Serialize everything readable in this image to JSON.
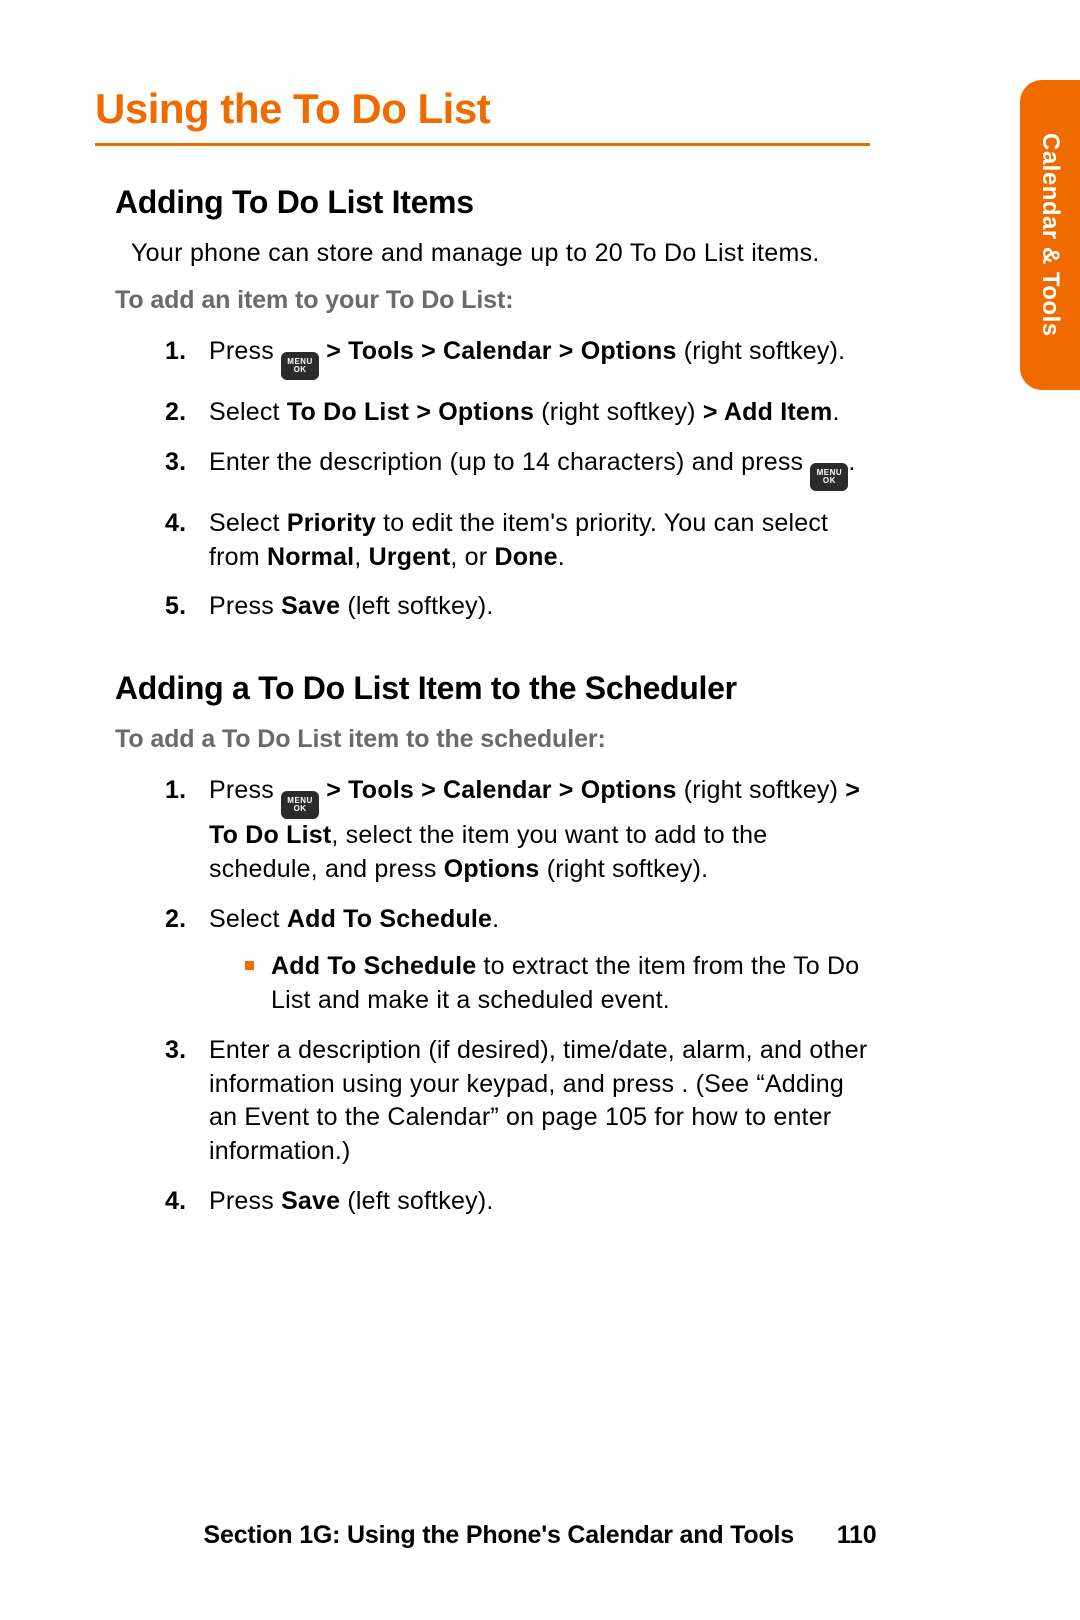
{
  "page_title": "Using the To Do List",
  "side_tab": "Calendar & Tools",
  "footer_section": "Section 1G: Using the Phone's Calendar and Tools",
  "footer_page": "110",
  "menuok": {
    "line1": "MENU",
    "line2": "OK"
  },
  "section1": {
    "heading": "Adding To Do List Items",
    "intro": "Your phone can store and manage up to 20 To Do List items.",
    "subhead": "To add an item to your To Do List:",
    "steps": {
      "s1_a": "Press ",
      "s1_b": " > Tools > Calendar > Options",
      "s1_c": " (right softkey).",
      "s2_a": "Select ",
      "s2_b": "To Do List > Options",
      "s2_c": " (right softkey) ",
      "s2_d": "> Add Item",
      "s2_e": ".",
      "s3_a": "Enter the description (up to 14 characters) and press ",
      "s3_b": ".",
      "s4_a": "Select ",
      "s4_b": "Priority",
      "s4_c": " to edit the item's priority. You can select from ",
      "s4_d": "Normal",
      "s4_e": ", ",
      "s4_f": "Urgent",
      "s4_g": ", or ",
      "s4_h": "Done",
      "s4_i": ".",
      "s5_a": "Press ",
      "s5_b": "Save",
      "s5_c": " (left softkey)."
    }
  },
  "section2": {
    "heading": "Adding a To Do List Item to the Scheduler",
    "subhead": "To add a To Do List item to the scheduler:",
    "steps": {
      "s1_a": "Press ",
      "s1_b": " > Tools > Calendar > Options",
      "s1_c": " (right softkey) ",
      "s1_d": "> To Do List",
      "s1_e": ", select the item you want to add to the schedule, and press ",
      "s1_f": "Options",
      "s1_g": " (right softkey).",
      "s2_a": "Select ",
      "s2_b": "Add To Schedule",
      "s2_c": ".",
      "bullet_b": "Add To Schedule",
      "bullet_c": " to extract the item from the To Do List and make it a scheduled event.",
      "s3": "Enter a description (if desired), time/date, alarm, and other information using your keypad, and press . (See “Adding an Event to the Calendar” on page 105 for how to enter information.)",
      "s4_a": "Press ",
      "s4_b": "Save",
      "s4_c": " (left softkey)."
    }
  },
  "nums": {
    "n1": "1.",
    "n2": "2.",
    "n3": "3.",
    "n4": "4.",
    "n5": "5."
  }
}
